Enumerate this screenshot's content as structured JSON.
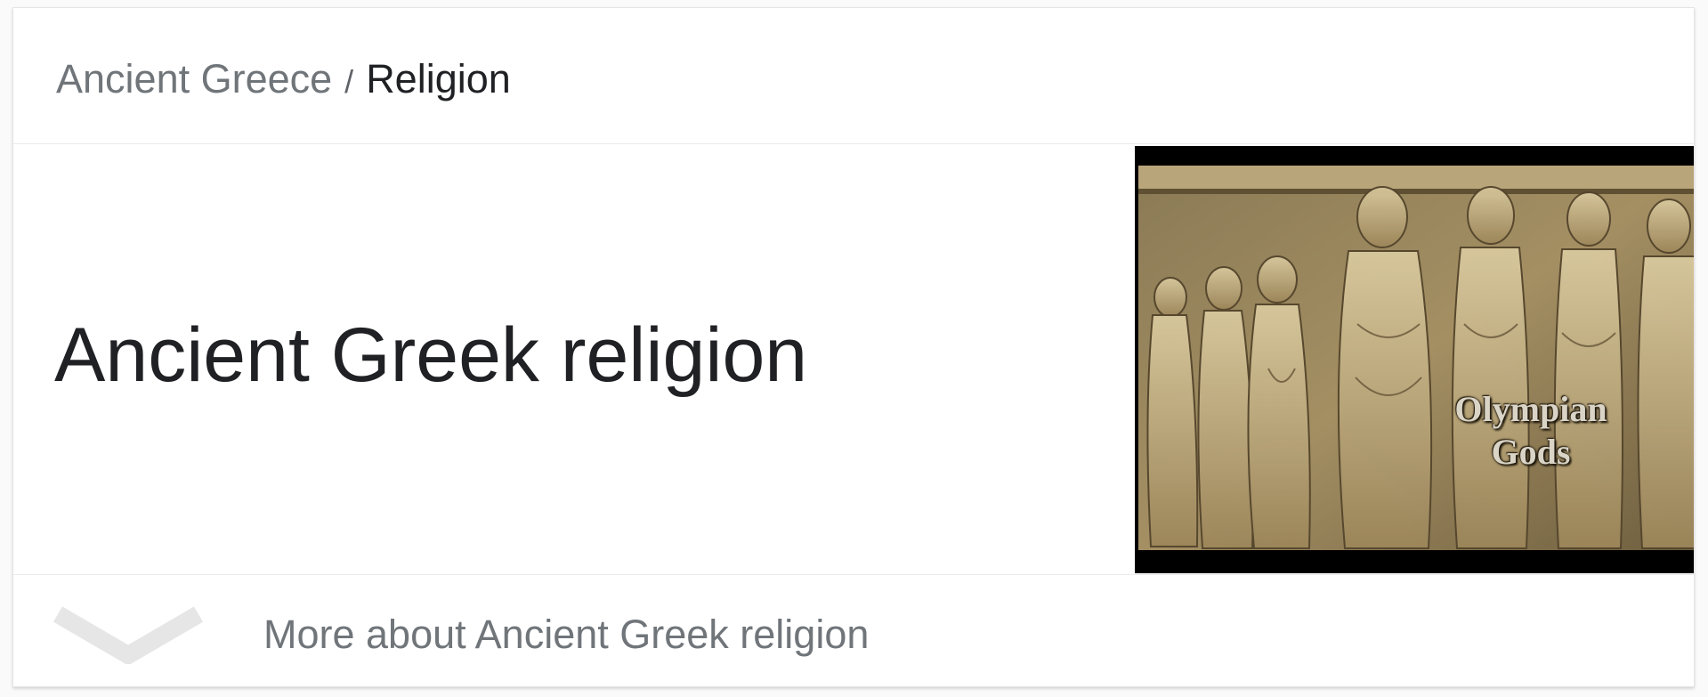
{
  "breadcrumb": {
    "parent_label": "Ancient Greece",
    "separator": "/",
    "current_label": "Religion"
  },
  "entity": {
    "title": "Ancient Greek religion"
  },
  "hero_image": {
    "overlay_line1": "Olympian",
    "overlay_line2": "Gods"
  },
  "more": {
    "label": "More about Ancient Greek religion",
    "icon": "chevron-down-icon"
  },
  "colors": {
    "text_primary": "#202124",
    "text_secondary": "#70757a",
    "divider": "#ebebeb"
  }
}
